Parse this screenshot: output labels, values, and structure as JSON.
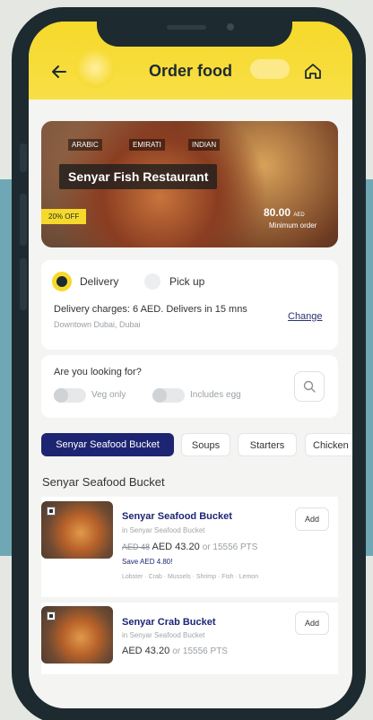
{
  "header": {
    "title": "Order food",
    "back_icon": "arrow-left-icon",
    "home_icon": "home-icon",
    "color": "#f6d92a"
  },
  "restaurant": {
    "tags": [
      "ARABIC",
      "EMIRATI",
      "INDIAN"
    ],
    "name": "Senyar Fish Restaurant",
    "offer": "20% OFF",
    "min_amount": "80.00",
    "min_currency": "AED",
    "min_label": "Minimum order"
  },
  "delivery": {
    "option_delivery": "Delivery",
    "option_pickup": "Pick up",
    "selected": "Delivery",
    "charges_text": "Delivery charges: 6 AED. Delivers in 15 mns",
    "location": "Downtown Dubai, Dubai",
    "change_label": "Change"
  },
  "filters": {
    "title": "Are you looking for?",
    "veg_only": "Veg only",
    "includes_egg": "Includes egg",
    "search_icon": "search-icon"
  },
  "categories": {
    "items": [
      "Senyar Seafood Bucket",
      "Soups",
      "Starters",
      "Chicken"
    ],
    "active": "Senyar Seafood Bucket",
    "accent": "#1d2573"
  },
  "section": {
    "title": "Senyar Seafood Bucket"
  },
  "dishes": [
    {
      "name": "Senyar Seafood Bucket",
      "category": "in Senyar Seafood Bucket",
      "old_price": "AED 48",
      "price": "AED 43.20",
      "points": "or 15556 PTS",
      "save": "Save AED 4.80!",
      "ingredients": "Lobster · Crab · Mussels · Shrimp · Fish · Lemon",
      "add_label": "Add"
    },
    {
      "name": "Senyar Crab Bucket",
      "category": "in Senyar Seafood Bucket",
      "price": "AED 43.20",
      "points": "or 15556 PTS",
      "add_label": "Add"
    }
  ]
}
